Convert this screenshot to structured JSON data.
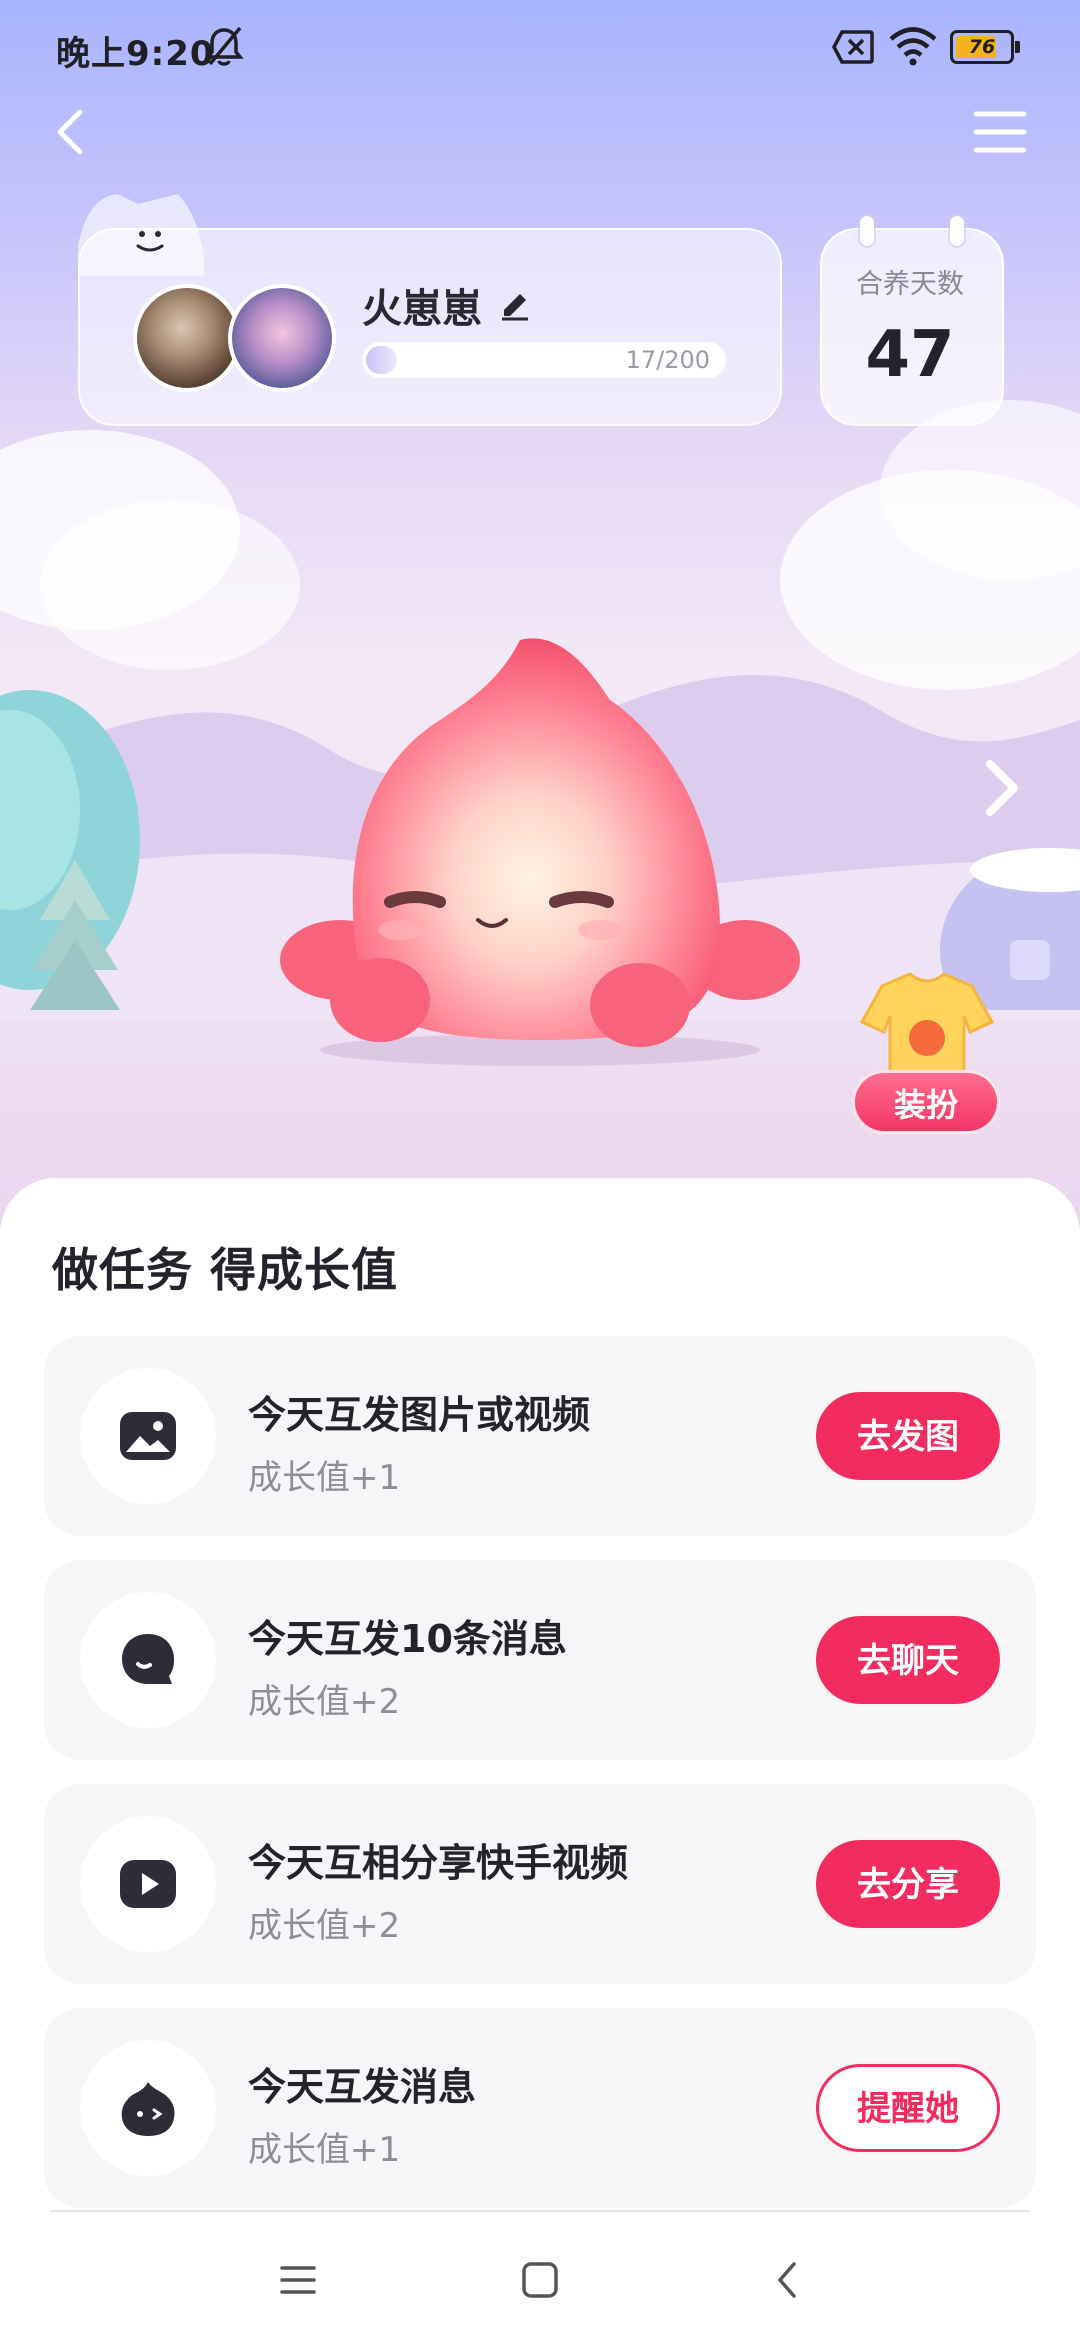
{
  "status_bar": {
    "time": "晚上9:20",
    "battery": "76",
    "battery_level": 0.76,
    "icons": [
      "bell-mute-icon",
      "sim-x-icon",
      "wifi-icon",
      "battery-icon"
    ]
  },
  "header": {
    "back_icon": "chevron-left-icon",
    "menu_icon": "hamburger-menu-icon"
  },
  "profile": {
    "pet_name": "火崽崽",
    "progress_text": "17/200",
    "progress_ratio": 0.085
  },
  "days": {
    "label": "合养天数",
    "value": "47"
  },
  "scene": {
    "next_icon": "chevron-right-icon",
    "dressup_label": "装扮"
  },
  "tasks": {
    "title": "做任务 得成长值",
    "items": [
      {
        "title": "今天互发图片或视频",
        "reward": "成长值+1",
        "button": "去发图",
        "icon": "image-icon"
      },
      {
        "title": "今天互发10条消息",
        "reward": "成长值+2",
        "button": "去聊天",
        "icon": "chat-bubble-icon"
      },
      {
        "title": "今天互相分享快手视频",
        "reward": "成长值+2",
        "button": "去分享",
        "icon": "play-video-icon"
      },
      {
        "title": "今天互发消息",
        "reward": "成长值+1",
        "button": "提醒她",
        "icon": "pet-face-icon"
      }
    ]
  },
  "nav": {
    "icons": [
      "menu-nav-icon",
      "home-nav-icon",
      "back-nav-icon"
    ]
  },
  "colors": {
    "accent": "#f22c5f",
    "sky_top": "#a8b4ff",
    "text_dark": "#24222a",
    "text_muted": "#8e8c96"
  }
}
